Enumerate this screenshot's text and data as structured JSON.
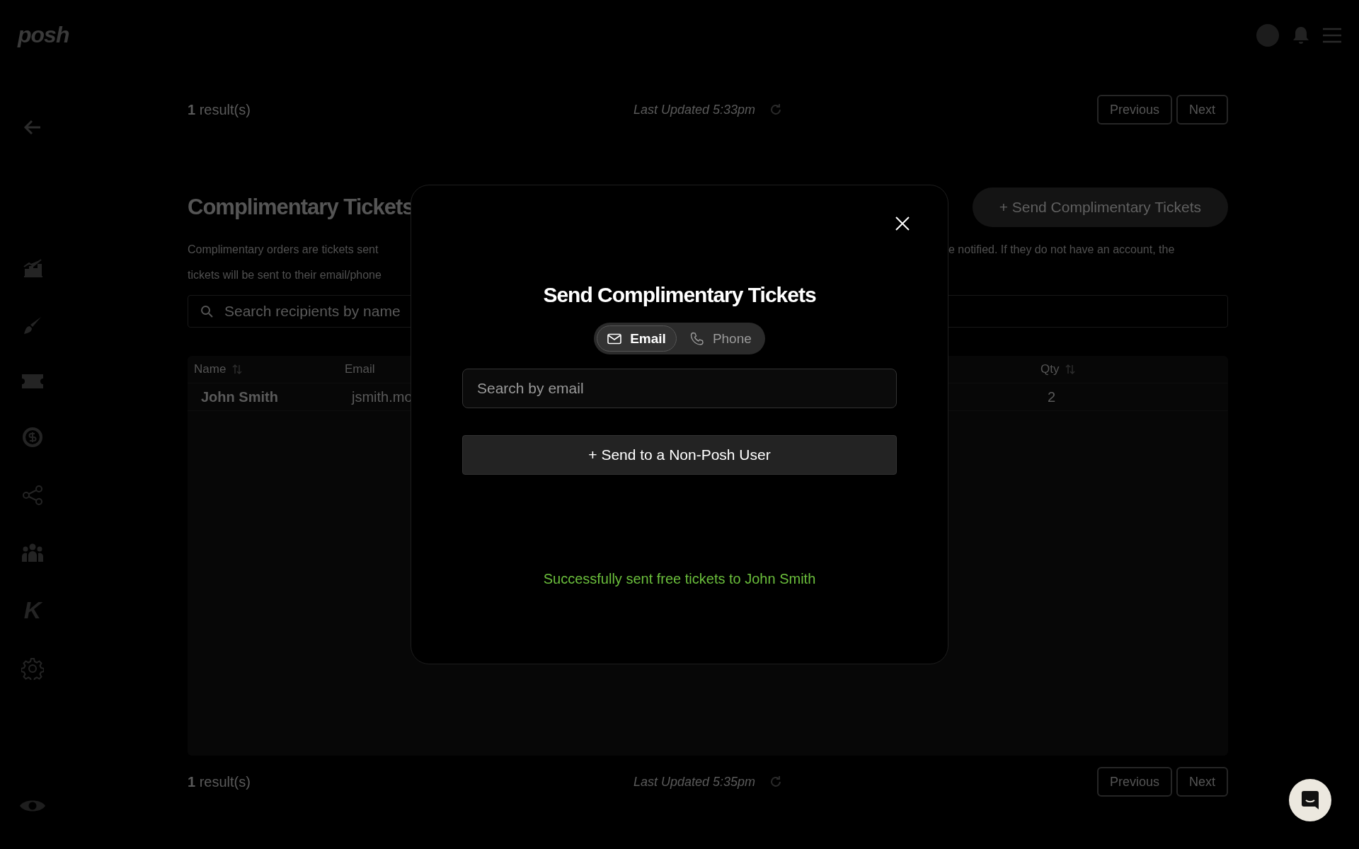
{
  "header": {
    "logo": "posh"
  },
  "sidebar": {
    "brand_mark": "K"
  },
  "top_results": {
    "count": "1",
    "label": "result(s)",
    "updated": "Last Updated 5:33pm",
    "buttons": [
      "Previous",
      "Next"
    ]
  },
  "section": {
    "title": "Complimentary Tickets",
    "action": "+ Send Complimentary Tickets",
    "description_left": [
      "Complimentary orders are tickets sent",
      "tickets will be sent to their email/phone"
    ],
    "description_right": "e notified. If they do not have an account, the",
    "search_placeholder": "Search recipients by name"
  },
  "table": {
    "columns": [
      {
        "label": "Name",
        "sortable": true
      },
      {
        "label": "Email",
        "sortable": false
      },
      {
        "label": "Qty",
        "sortable": true
      }
    ],
    "rows": [
      {
        "cells": [
          "John Smith",
          "jsmith.mo",
          "2"
        ]
      }
    ]
  },
  "bottom_results": {
    "count": "1",
    "label": "result(s)",
    "updated": "Last Updated 5:35pm",
    "buttons": [
      "Previous",
      "Next"
    ]
  },
  "modal": {
    "title": "Send Complimentary Tickets",
    "tabs": [
      {
        "label": "Email",
        "kind": "email",
        "selected": true
      },
      {
        "label": "Phone",
        "kind": "phone",
        "selected": false
      }
    ],
    "placeholder": "Search by email",
    "button": "+ Send to a Non-Posh User",
    "message": "Successfully sent free tickets to John Smith"
  }
}
